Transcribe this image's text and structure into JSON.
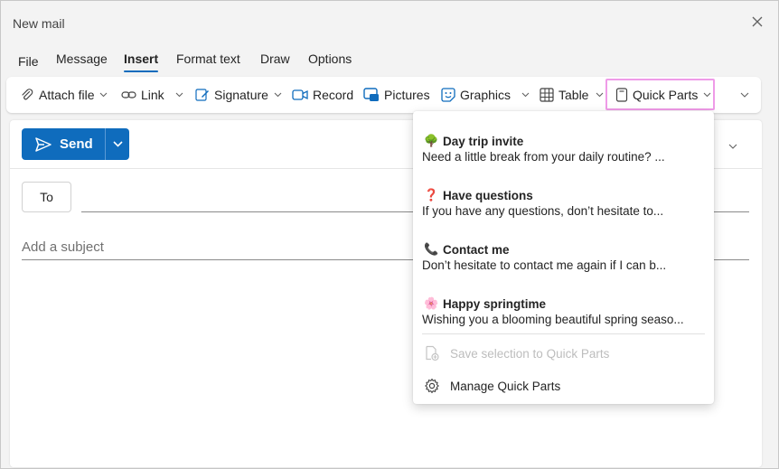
{
  "window": {
    "title": "New mail"
  },
  "menu": {
    "items": [
      {
        "label": "File",
        "active": false
      },
      {
        "label": "Message",
        "active": false
      },
      {
        "label": "Insert",
        "active": true
      },
      {
        "label": "Format text",
        "active": false
      },
      {
        "label": "Draw",
        "active": false
      },
      {
        "label": "Options",
        "active": false
      }
    ]
  },
  "ribbon": {
    "attach_file": "Attach file",
    "link": "Link",
    "signature": "Signature",
    "record": "Record",
    "pictures": "Pictures",
    "graphics": "Graphics",
    "table": "Table",
    "quick_parts": "Quick Parts"
  },
  "compose": {
    "send_label": "Send",
    "to_label": "To",
    "to_value": "",
    "subject_placeholder": "Add a subject"
  },
  "quick_parts_menu": {
    "items": [
      {
        "icon": "tree-icon",
        "emoji": "🌳",
        "title": "Day trip invite",
        "preview": "Need a little break from your daily routine? ..."
      },
      {
        "icon": "question-icon",
        "emoji": "❓",
        "title": "Have questions",
        "preview": "If you have any questions, don’t hesitate to..."
      },
      {
        "icon": "phone-icon",
        "emoji": "📞",
        "title": "Contact me",
        "preview": "Don’t hesitate to contact me again if I can b..."
      },
      {
        "icon": "blossom-icon",
        "emoji": "🌸",
        "title": "Happy springtime",
        "preview": "Wishing you a blooming beautiful spring seaso..."
      }
    ],
    "save_selection": "Save selection to Quick Parts",
    "manage": "Manage Quick Parts"
  },
  "colors": {
    "accent": "#0f6cbd",
    "highlight_border": "#ef9be8"
  }
}
